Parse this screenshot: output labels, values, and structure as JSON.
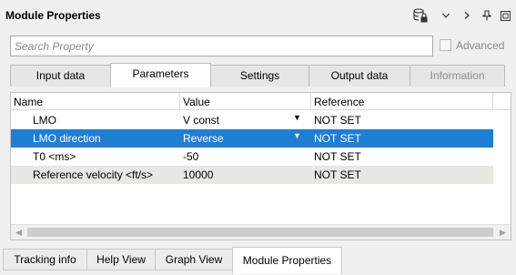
{
  "panel": {
    "title": "Module Properties",
    "toolbar_icons": [
      "database-lock-icon",
      "chevron-down-icon",
      "chevron-right-icon",
      "pin-icon",
      "restore-window-icon"
    ]
  },
  "search": {
    "placeholder": "Search Property",
    "advanced_label": "Advanced",
    "advanced_checked": false
  },
  "tabs": [
    {
      "label": "Input data",
      "state": "normal"
    },
    {
      "label": "Parameters",
      "state": "active"
    },
    {
      "label": "Settings",
      "state": "normal"
    },
    {
      "label": "Output data",
      "state": "normal"
    },
    {
      "label": "Information",
      "state": "disabled"
    }
  ],
  "table": {
    "headers": {
      "name": "Name",
      "value": "Value",
      "reference": "Reference"
    },
    "rows": [
      {
        "name": "LMO",
        "value": "V const",
        "reference": "NOT SET",
        "dropdown": true
      },
      {
        "name": "LMO direction",
        "value": "Reverse",
        "reference": "NOT SET",
        "dropdown": true,
        "selected": true
      },
      {
        "name": "T0 <ms>",
        "value": "-50",
        "reference": "NOT SET"
      },
      {
        "name": "Reference velocity <ft/s>",
        "value": "10000",
        "reference": "NOT SET"
      }
    ]
  },
  "bottom_tabs": [
    {
      "label": "Tracking info",
      "state": "normal"
    },
    {
      "label": "Help View",
      "state": "normal"
    },
    {
      "label": "Graph View",
      "state": "normal"
    },
    {
      "label": "Module Properties",
      "state": "active"
    }
  ],
  "colors": {
    "selection": "#1e7fd4",
    "alt_row": "#e9e7e3"
  }
}
